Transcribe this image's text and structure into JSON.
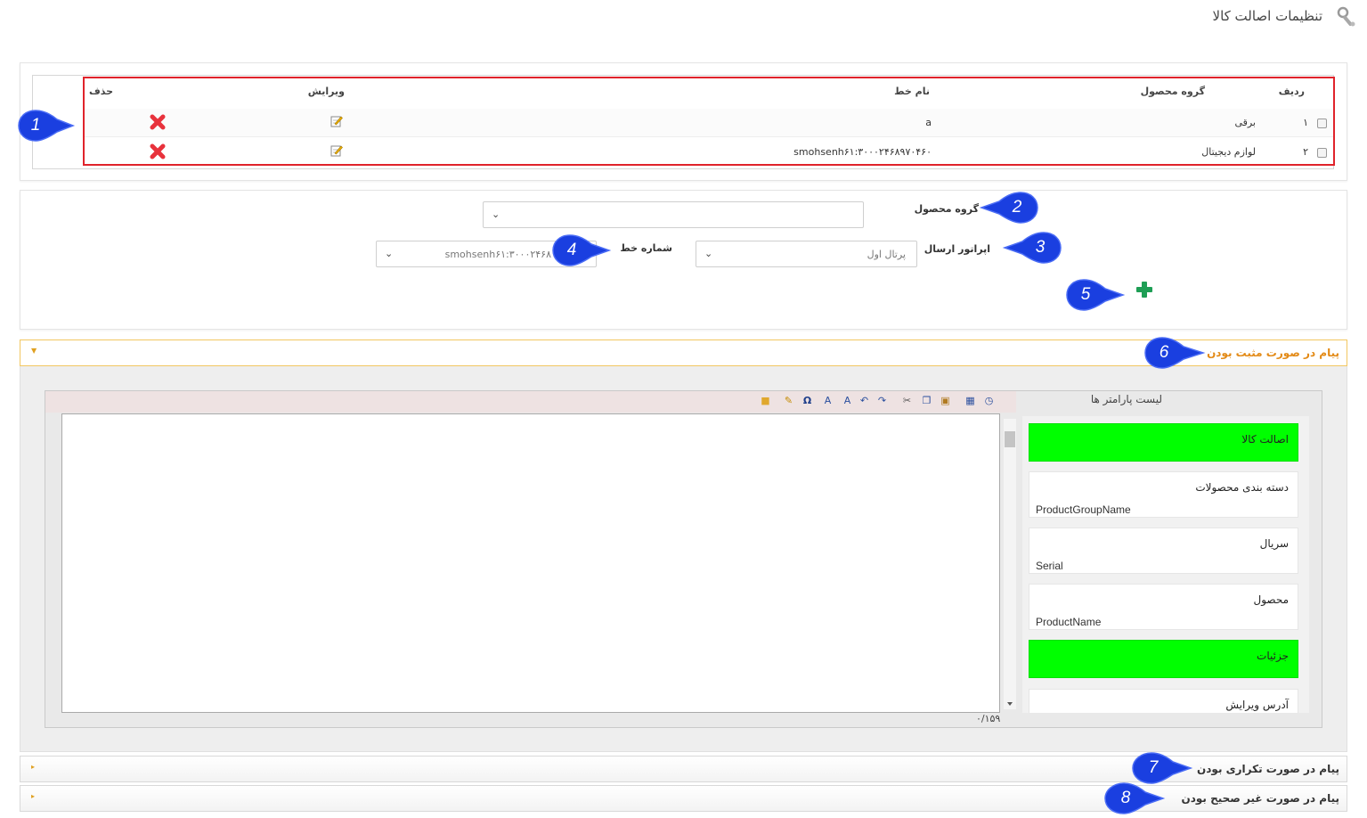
{
  "header": {
    "title": "تنظیمات اصالت کالا"
  },
  "table": {
    "headers": {
      "row": "ردیف",
      "group": "گروه محصول",
      "line": "نام خط",
      "edit": "ویرایش",
      "delete": "حذف"
    },
    "rows": [
      {
        "index": "۱",
        "group": "برقی",
        "line": "a"
      },
      {
        "index": "۲",
        "group": "لوازم دیجیتال",
        "line": "smohsenh۶۱:۳۰۰۰۲۴۶۸۹۷۰۴۶۰"
      }
    ]
  },
  "form": {
    "product_group_label": "گروه محصول",
    "product_group_value": "",
    "operator_label": "اپراتور ارسال",
    "operator_value": "پرتال اول",
    "line_number_label": "شماره خط",
    "line_number_value": "smohsenh۶۱:۳۰۰۰۲۴۶۸"
  },
  "callouts": [
    "1",
    "2",
    "3",
    "4",
    "5",
    "6",
    "7",
    "8"
  ],
  "accordions": {
    "positive": "پیام در صورت مثبت بودن",
    "duplicate": "پیام در صورت تکراری بودن",
    "invalid": "پیام در صورت غیر صحیح بودن"
  },
  "editor": {
    "char_count": "۰/۱۵۹"
  },
  "params": {
    "title": "لیست پارامتر ها",
    "items": [
      {
        "fa": "اصالت کالا",
        "en": "",
        "highlight": true
      },
      {
        "fa": "دسته بندی محصولات",
        "en": "ProductGroupName",
        "highlight": false
      },
      {
        "fa": "سریال",
        "en": "Serial",
        "highlight": false
      },
      {
        "fa": "محصول",
        "en": "ProductName",
        "highlight": false
      },
      {
        "fa": "جزئیات",
        "en": "",
        "highlight": true
      },
      {
        "fa": "آدرس ویرایش",
        "en": "",
        "highlight": false
      }
    ]
  },
  "colors": {
    "accent": "#e38a16",
    "callout": "#1a3fe0",
    "highlight": "#00ff00",
    "delete": "#e8323c",
    "add": "#1e9e55"
  }
}
